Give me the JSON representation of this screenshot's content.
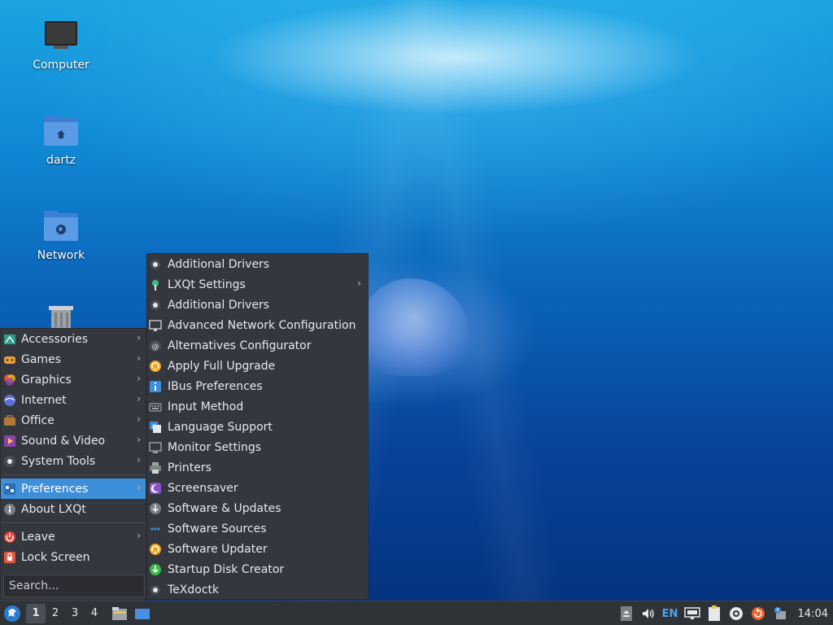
{
  "desktop": {
    "icons": [
      {
        "label": "Computer",
        "icon": "computer-icon"
      },
      {
        "label": "dartz",
        "icon": "home-folder-icon"
      },
      {
        "label": "Network",
        "icon": "network-folder-icon"
      },
      {
        "label": "",
        "icon": "trash-icon"
      }
    ]
  },
  "main_menu": {
    "items": [
      {
        "label": "Accessories",
        "icon": "accessories-icon",
        "submenu": true
      },
      {
        "label": "Games",
        "icon": "games-icon",
        "submenu": true
      },
      {
        "label": "Graphics",
        "icon": "graphics-icon",
        "submenu": true
      },
      {
        "label": "Internet",
        "icon": "internet-icon",
        "submenu": true
      },
      {
        "label": "Office",
        "icon": "office-icon",
        "submenu": true
      },
      {
        "label": "Sound & Video",
        "icon": "sound-video-icon",
        "submenu": true
      },
      {
        "label": "System Tools",
        "icon": "system-tools-icon",
        "submenu": true
      },
      {
        "label": "Preferences",
        "icon": "preferences-icon",
        "submenu": true,
        "active": true
      },
      {
        "label": "About LXQt",
        "icon": "info-icon",
        "submenu": false
      },
      {
        "label": "Leave",
        "icon": "power-icon",
        "submenu": true
      },
      {
        "label": "Lock Screen",
        "icon": "lock-icon",
        "submenu": false
      }
    ],
    "search_placeholder": "Search..."
  },
  "preferences_submenu": {
    "items": [
      {
        "label": "Additional Drivers",
        "icon": "dot-icon"
      },
      {
        "label": "LXQt Settings",
        "icon": "lxqt-settings-icon",
        "submenu": true
      },
      {
        "label": "Additional Drivers",
        "icon": "dot-icon"
      },
      {
        "label": "Advanced Network Configuration",
        "icon": "network-config-icon"
      },
      {
        "label": "Alternatives Configurator",
        "icon": "alternatives-icon"
      },
      {
        "label": "Apply Full Upgrade",
        "icon": "upgrade-icon"
      },
      {
        "label": "IBus Preferences",
        "icon": "ibus-icon"
      },
      {
        "label": "Input Method",
        "icon": "keyboard-icon"
      },
      {
        "label": "Language Support",
        "icon": "language-icon"
      },
      {
        "label": "Monitor Settings",
        "icon": "monitor-icon"
      },
      {
        "label": "Printers",
        "icon": "printer-icon"
      },
      {
        "label": "Screensaver",
        "icon": "screensaver-icon"
      },
      {
        "label": "Software & Updates",
        "icon": "software-updates-icon"
      },
      {
        "label": "Software Sources",
        "icon": "software-sources-icon"
      },
      {
        "label": "Software Updater",
        "icon": "software-updater-icon"
      },
      {
        "label": "Startup Disk Creator",
        "icon": "startup-disk-icon"
      },
      {
        "label": "TeXdoctk",
        "icon": "dot-icon"
      }
    ]
  },
  "taskbar": {
    "workspaces": [
      "1",
      "2",
      "3",
      "4"
    ],
    "active_workspace": "1",
    "language": "EN",
    "clock": "14:04"
  },
  "colors": {
    "menu_bg": "#34373e",
    "highlight": "#3d8fd9",
    "taskbar_bg": "#2f3237"
  }
}
